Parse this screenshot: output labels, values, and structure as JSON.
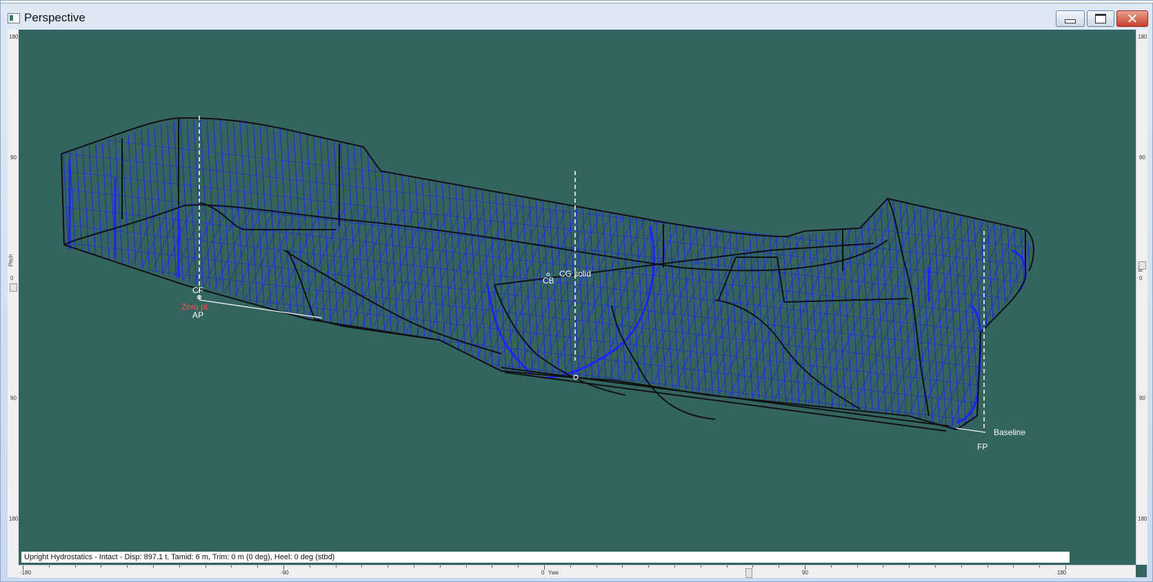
{
  "window": {
    "title": "Perspective",
    "minimize_label": "",
    "maximize_label": "",
    "close_glyph": "✕"
  },
  "rulers": {
    "left": {
      "name": "Pitch",
      "ticks": [
        "180",
        "90",
        "0",
        "90",
        "180"
      ]
    },
    "right": {
      "name": "Roll",
      "ticks": [
        "180",
        "90",
        "0",
        "90",
        "180"
      ]
    },
    "bottom": {
      "name": "Yaw",
      "ticks": [
        "-180",
        "-90",
        "0",
        "90",
        "180"
      ]
    }
  },
  "viewport": {
    "background": "#336460",
    "labels": {
      "cf": "CF",
      "zero_pt": "Zero pt.",
      "ap": "AP",
      "cb": "CB",
      "cg_solid": "CG solid",
      "baseline": "Baseline",
      "fp": "FP"
    },
    "colors": {
      "hull_grid": "#1a1aff",
      "hull_edges": "#111111",
      "markers": "#ffffff",
      "zero_pt": "#ff5555"
    }
  },
  "status_bar": {
    "text": "Upright Hydrostatics - Intact - Disp: 897.1 t, Tamid: 6 m, Trim: 0 m (0 deg), Heel: 0 deg (stbd)"
  }
}
